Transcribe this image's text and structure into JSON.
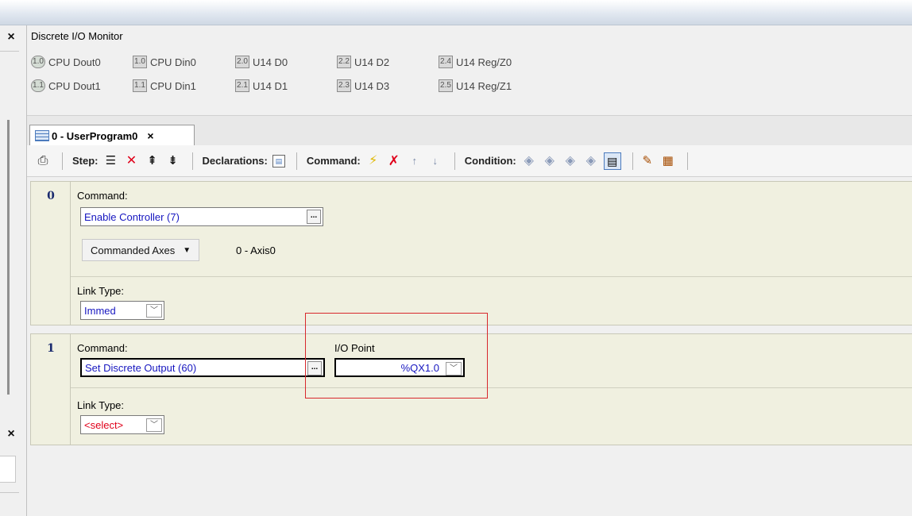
{
  "left_panel": {
    "close_top": "×",
    "close_bottom": "×"
  },
  "dio_monitor": {
    "title": "Discrete I/O Monitor",
    "items": [
      {
        "indicator": "1.0",
        "label": "CPU Dout0",
        "shape": "round"
      },
      {
        "indicator": "1.1",
        "label": "CPU Dout1",
        "shape": "round"
      },
      {
        "indicator": "1.0",
        "label": "CPU Din0",
        "shape": "square"
      },
      {
        "indicator": "1.1",
        "label": "CPU Din1",
        "shape": "square"
      },
      {
        "indicator": "2.0",
        "label": "U14 D0",
        "shape": "square"
      },
      {
        "indicator": "2.1",
        "label": "U14 D1",
        "shape": "square"
      },
      {
        "indicator": "2.2",
        "label": "U14 D2",
        "shape": "square"
      },
      {
        "indicator": "2.3",
        "label": "U14 D3",
        "shape": "square"
      },
      {
        "indicator": "2.4",
        "label": "U14 Reg/Z0",
        "shape": "square"
      },
      {
        "indicator": "2.5",
        "label": "U14 Reg/Z1",
        "shape": "square"
      }
    ]
  },
  "tab": {
    "label": "0 - UserProgram0",
    "close": "×"
  },
  "toolbar": {
    "step_label": "Step:",
    "declarations_label": "Declarations:",
    "command_label": "Command:",
    "condition_label": "Condition:"
  },
  "steps": [
    {
      "number": "0",
      "command_label": "Command:",
      "command_value": "Enable Controller (7)",
      "command_button": "...",
      "commanded_axes_label": "Commanded Axes",
      "axis_value": "0 - Axis0",
      "link_type_label": "Link Type:",
      "link_type_value": "Immed"
    },
    {
      "number": "1",
      "command_label": "Command:",
      "command_value": "Set Discrete Output (60)",
      "command_button": "...",
      "io_point_label": "I/O Point",
      "io_point_value": "%QX1.0",
      "link_type_label": "Link Type:",
      "link_type_value": "<select>"
    }
  ],
  "colors": {
    "field_text": "#1616c0",
    "select_placeholder": "#e0001a",
    "step_number": "#1a2a6e",
    "highlight_box": "#d8282c",
    "step_background": "#f0f0e0"
  }
}
